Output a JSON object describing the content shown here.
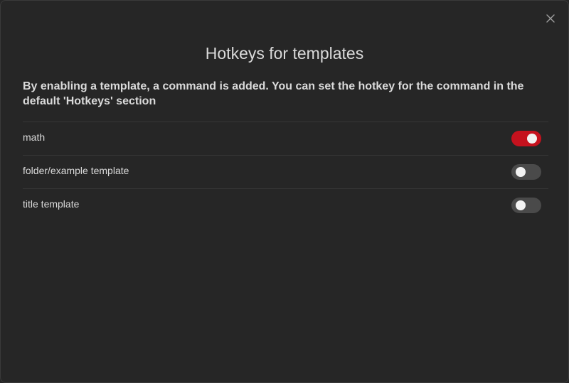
{
  "modal": {
    "title": "Hotkeys for templates",
    "description": "By enabling a template, a command is added. You can set the hotkey for the command in the default 'Hotkeys' section",
    "close_icon": "close-icon"
  },
  "templates": [
    {
      "label": "math",
      "enabled": true
    },
    {
      "label": "folder/example template",
      "enabled": false
    },
    {
      "label": "title template",
      "enabled": false
    }
  ],
  "colors": {
    "toggle_on": "#c5121e",
    "toggle_off": "#4a4a4a",
    "background": "#262626"
  }
}
